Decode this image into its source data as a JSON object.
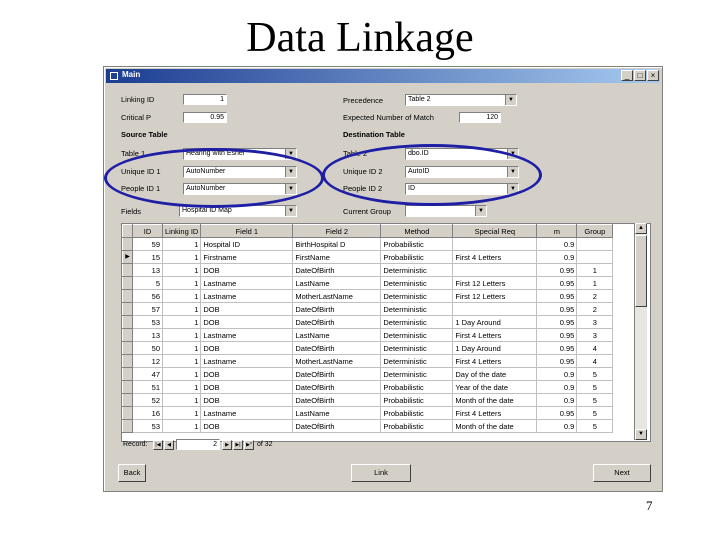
{
  "slide": {
    "title": "Data Linkage",
    "page_number": "7"
  },
  "window": {
    "title": "Main",
    "min": "_",
    "max": "□",
    "close": "×"
  },
  "form": {
    "linking_id": {
      "label": "Linking ID",
      "value": "1"
    },
    "critical_p": {
      "label": "Critical P",
      "value": "0.95"
    },
    "precedence": {
      "label": "Precedence",
      "value": "Table 2"
    },
    "expected_matches": {
      "label": "Expected Number of Match",
      "value": "120"
    },
    "source_section": "Source Table",
    "destination_section": "Destination Table",
    "table1": {
      "label": "Table 1",
      "value": "Hearing with Esher"
    },
    "table2": {
      "label": "Table 2",
      "value": "dbo.ID"
    },
    "unique_id1": {
      "label": "Unique ID 1",
      "value": "AutoNumber"
    },
    "unique_id2": {
      "label": "Unique ID 2",
      "value": "AutoID"
    },
    "people_id1": {
      "label": "People ID 1",
      "value": "AutoNumber"
    },
    "people_id2": {
      "label": "People ID 2",
      "value": "ID"
    },
    "fields": {
      "label": "Fields",
      "value": "Hospital ID Map"
    },
    "current_group": {
      "label": "Current Group",
      "value": ""
    }
  },
  "grid": {
    "columns": [
      "ID",
      "Linking ID",
      "Field 1",
      "Field 2",
      "Method",
      "Special Req",
      "m",
      "Group"
    ],
    "rows": [
      {
        "sel": "",
        "id": "59",
        "link": "1",
        "f1": "Hospital ID",
        "f2": "BirthHospital D",
        "method": "Probabilistic",
        "req": "",
        "m": "0.9",
        "group": ""
      },
      {
        "sel": "▶",
        "id": "15",
        "link": "1",
        "f1": "Firstname",
        "f2": "FirstName",
        "method": "Probabilistic",
        "req": "First 4 Letters",
        "m": "0.9",
        "group": ""
      },
      {
        "sel": "",
        "id": "13",
        "link": "1",
        "f1": "DOB",
        "f2": "DateOfBirth",
        "method": "Deterministic",
        "req": "",
        "m": "0.95",
        "group": "1"
      },
      {
        "sel": "",
        "id": "5",
        "link": "1",
        "f1": "Lastname",
        "f2": "LastName",
        "method": "Deterministic",
        "req": "First 12 Letters",
        "m": "0.95",
        "group": "1"
      },
      {
        "sel": "",
        "id": "56",
        "link": "1",
        "f1": "Lastname",
        "f2": "MotherLastName",
        "method": "Deterministic",
        "req": "First 12 Letters",
        "m": "0.95",
        "group": "2"
      },
      {
        "sel": "",
        "id": "57",
        "link": "1",
        "f1": "DOB",
        "f2": "DateOfBirth",
        "method": "Deterministic",
        "req": "",
        "m": "0.95",
        "group": "2"
      },
      {
        "sel": "",
        "id": "53",
        "link": "1",
        "f1": "DOB",
        "f2": "DateOfBirth",
        "method": "Deterministic",
        "req": "1 Day Around",
        "m": "0.95",
        "group": "3"
      },
      {
        "sel": "",
        "id": "13",
        "link": "1",
        "f1": "Lastname",
        "f2": "LastName",
        "method": "Deterministic",
        "req": "First 4 Letters",
        "m": "0.95",
        "group": "3"
      },
      {
        "sel": "",
        "id": "50",
        "link": "1",
        "f1": "DOB",
        "f2": "DateOfBirth",
        "method": "Deterministic",
        "req": "1 Day Around",
        "m": "0.95",
        "group": "4"
      },
      {
        "sel": "",
        "id": "12",
        "link": "1",
        "f1": "Lastname",
        "f2": "MotherLastName",
        "method": "Deterministic",
        "req": "First 4 Letters",
        "m": "0.95",
        "group": "4"
      },
      {
        "sel": "",
        "id": "47",
        "link": "1",
        "f1": "DOB",
        "f2": "DateOfBirth",
        "method": "Deterministic",
        "req": "Day of the date",
        "m": "0.9",
        "group": "5"
      },
      {
        "sel": "",
        "id": "51",
        "link": "1",
        "f1": "DOB",
        "f2": "DateOfBirth",
        "method": "Probabilistic",
        "req": "Year of the date",
        "m": "0.9",
        "group": "5"
      },
      {
        "sel": "",
        "id": "52",
        "link": "1",
        "f1": "DOB",
        "f2": "DateOfBirth",
        "method": "Probabilistic",
        "req": "Month of the date",
        "m": "0.9",
        "group": "5"
      },
      {
        "sel": "",
        "id": "16",
        "link": "1",
        "f1": "Lastname",
        "f2": "LastName",
        "method": "Probabilistic",
        "req": "First 4 Letters",
        "m": "0.95",
        "group": "5"
      },
      {
        "sel": "",
        "id": "53",
        "link": "1",
        "f1": "DOB",
        "f2": "DateOfBirth",
        "method": "Probabilistic",
        "req": "Month of the date",
        "m": "0.9",
        "group": "5"
      }
    ]
  },
  "navigation": {
    "label": "Record:",
    "current": "2",
    "of_text": "of 32"
  },
  "buttons": {
    "back": "Back",
    "link": "Link",
    "next": "Next"
  }
}
